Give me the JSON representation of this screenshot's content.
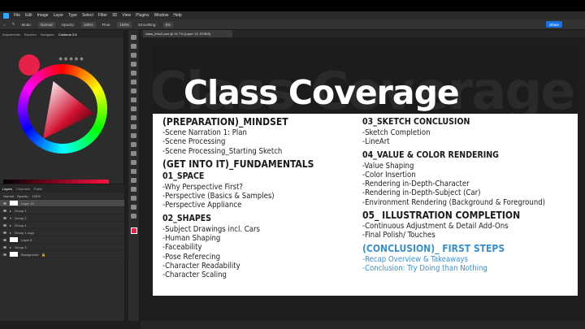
{
  "menu": [
    "File",
    "Edit",
    "Image",
    "Layer",
    "Type",
    "Select",
    "Filter",
    "3D",
    "View",
    "Plugins",
    "Window",
    "Help"
  ],
  "options": {
    "mode_label": "Mode:",
    "mode_value": "Normal",
    "opacity_label": "Opacity:",
    "opacity_value": "100%",
    "flow_label": "Flow:",
    "flow_value": "100%",
    "smoothing_label": "Smoothing:",
    "smoothing_value": "0%"
  },
  "share_label": "Share",
  "panel_tabs": [
    "Adjustments",
    "Brushes",
    "Navigator",
    "Coolorus 2.6"
  ],
  "document_tab": "class_intro2.psd @ 24.7% (Layer 13, RGB/8)",
  "layers_tabs": [
    "Layers",
    "Channels",
    "Paths"
  ],
  "layers_blend": "Normal",
  "layers_opacity_label": "Opacity:",
  "layers_opacity_value": "100%",
  "layers": [
    "Layer 13",
    "Group 1",
    "Group 2",
    "Group 4",
    "Group 1 copy",
    "Layer 5",
    "Group 3",
    "Background"
  ],
  "canvas": {
    "bg_word": "Class Coverage",
    "title": "Class Coverage",
    "left_sections": [
      {
        "heading": "(PREPARATION)_MINDSET",
        "items": [
          "-Scene Narration 1: Plan",
          "-Scene Processing",
          "-Scene Processing_Starting Sketch"
        ]
      },
      {
        "heading": "(GET INTO IT)_FUNDAMENTALS",
        "items": []
      },
      {
        "heading": "01_SPACE",
        "items": [
          "-Why Perspective First?",
          "-Perspective (Basics & Samples)",
          "-Perspective Appliance"
        ]
      },
      {
        "heading": "02_SHAPES",
        "items": [
          "-Subject Drawings incl. Cars",
          "-Human Shaping",
          "-Faceability",
          "-Pose Referecing",
          "-Character Readability",
          "-Character Scaling"
        ]
      }
    ],
    "right_sections": [
      {
        "heading": "03_SKETCH CONCLUSION",
        "items": [
          "-Sketch Completion",
          "-LineArt"
        ]
      },
      {
        "heading": "04_VALUE & COLOR RENDERING",
        "items": [
          "-Value Shaping",
          "-Color Insertion",
          "-Rendering in-Depth-Character",
          "-Rendering in-Depth-Subject (Car)",
          "-Environment Rendering (Background & Foreground)"
        ]
      },
      {
        "heading": "05_ ILLUSTRATION COMPLETION",
        "items": [
          "-Continuous Adjustment & Detail Add-Ons",
          "-Final Polish/ Touches"
        ]
      },
      {
        "heading": "(CONCLUSION)_ FIRST STEPS",
        "items": [
          "-Recap Overview & Takeaways",
          "-Conclusion: Try Doing than Nothing"
        ]
      }
    ]
  },
  "colors": {
    "accent_blue": "#3a8fd0",
    "foreground_swatch": "#e8204a"
  }
}
